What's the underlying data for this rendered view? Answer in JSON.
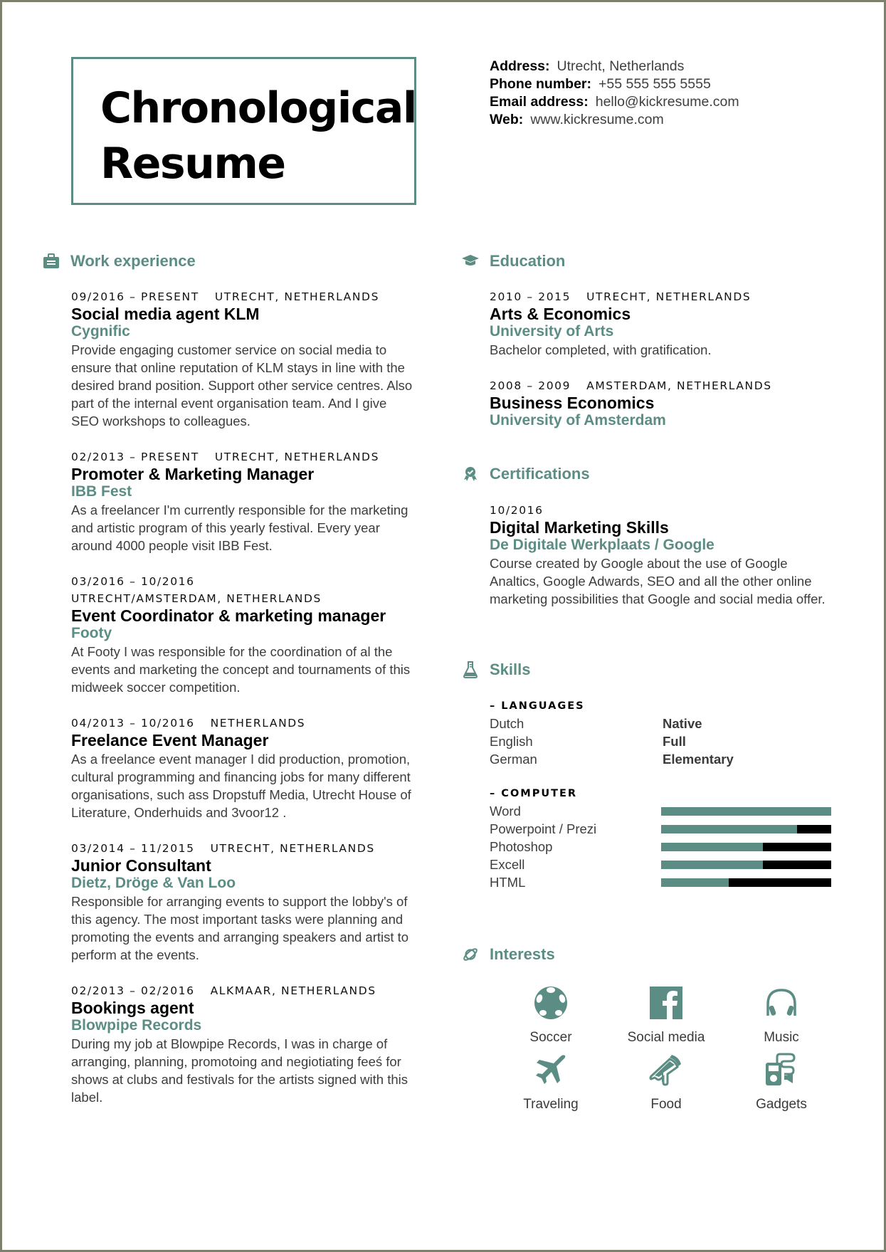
{
  "header": {
    "title_line1": "Chronological",
    "title_line2": "Resume"
  },
  "contact": [
    {
      "label": "Address:",
      "value": "Utrecht, Netherlands"
    },
    {
      "label": "Phone number:",
      "value": "+55 555 555 5555"
    },
    {
      "label": "Email address:",
      "value": "hello@kickresume.com"
    },
    {
      "label": "Web:",
      "value": "www.kickresume.com"
    }
  ],
  "colors": {
    "accent": "#5b8d84",
    "frame": "#7d806a",
    "bar_empty": "#000000"
  },
  "work": {
    "title": "Work experience",
    "icon": "briefcase-icon",
    "entries": [
      {
        "dates": "09/2016 – Present",
        "location": "Utrecht, Netherlands",
        "role": "Social media agent KLM",
        "org": "Cygnific",
        "desc": "Provide engaging customer service on social media to ensure that online reputation of KLM stays in line with the desired brand position. Support other service centres. Also part of the internal event organisation team. And I give SEO workshops to colleagues."
      },
      {
        "dates": "02/2013 – Present",
        "location": "Utrecht, Netherlands",
        "role": "Promoter & Marketing Manager",
        "org": "IBB Fest",
        "desc": "As a freelancer I'm currently responsible for the marketing and artistic program of this yearly festival. Every year around 4000 people visit IBB Fest."
      },
      {
        "dates": "03/2016 – 10/2016",
        "location": "Utrecht/Amsterdam, Netherlands",
        "role": "Event Coordinator & marketing manager",
        "org": "Footy",
        "desc": "At Footy I was responsible for the coordination of al the events and marketing the concept and tournaments of this midweek soccer competition."
      },
      {
        "dates": "04/2013 – 10/2016",
        "location": "Netherlands",
        "role": "Freelance Event Manager",
        "org": "",
        "desc": "As a freelance event manager I did production, promotion, cultural programming and financing jobs for many different organisations, such ass Dropstuff Media, Utrecht House of Literature, Onderhuids and 3voor12 ."
      },
      {
        "dates": "03/2014 – 11/2015",
        "location": "Utrecht, Netherlands",
        "role": "Junior Consultant",
        "org": "Dietz, Dröge & Van Loo",
        "desc": "Responsible for arranging events to support the lobby's of this agency. The most important tasks were planning and promoting the events and arranging speakers and artist to perform at the events."
      },
      {
        "dates": "02/2013 – 02/2016",
        "location": "Alkmaar, Netherlands",
        "role": "Bookings agent",
        "org": "Blowpipe Records",
        "desc": "During my job at Blowpipe Records, I was in charge of arranging, planning, promotoing  and negiotiating feeś for shows at clubs and festivals for the artists signed with this label."
      }
    ]
  },
  "education": {
    "title": "Education",
    "icon": "graduation-cap-icon",
    "entries": [
      {
        "dates": "2010 – 2015",
        "location": "Utrecht, Netherlands",
        "role": "Arts & Economics",
        "org": "University of Arts",
        "desc": "Bachelor completed, with gratification."
      },
      {
        "dates": "2008 – 2009",
        "location": "Amsterdam, Netherlands",
        "role": "Business Economics",
        "org": "University of Amsterdam",
        "desc": ""
      }
    ]
  },
  "certifications": {
    "title": "Certifications",
    "icon": "award-badge-icon",
    "entries": [
      {
        "dates": "10/2016",
        "location": "",
        "role": "Digital Marketing Skills",
        "org": "De Digitale Werkplaats / Google",
        "desc": "Course created by Google about the use of Google Analtics, Google Adwards, SEO and all the other online marketing possibilities that Google and social media offer."
      }
    ]
  },
  "skills": {
    "title": "Skills",
    "icon": "flask-icon",
    "languages_label": "– Languages",
    "languages": [
      {
        "name": "Dutch",
        "level": "Native"
      },
      {
        "name": "English",
        "level": "Full"
      },
      {
        "name": "German",
        "level": "Elementary"
      }
    ],
    "computer_label": "– Computer",
    "computer": [
      {
        "name": "Word",
        "level": 1.0
      },
      {
        "name": "Powerpoint / Prezi",
        "level": 0.8
      },
      {
        "name": "Photoshop",
        "level": 0.6
      },
      {
        "name": "Excell",
        "level": 0.6
      },
      {
        "name": "HTML",
        "level": 0.4
      }
    ]
  },
  "interests": {
    "title": "Interests",
    "icon": "planet-icon",
    "items": [
      {
        "label": "Soccer",
        "icon": "soccer-ball-icon"
      },
      {
        "label": "Social media",
        "icon": "facebook-icon"
      },
      {
        "label": "Music",
        "icon": "headphones-icon"
      },
      {
        "label": "Traveling",
        "icon": "airplane-icon"
      },
      {
        "label": "Food",
        "icon": "pizza-slice-icon"
      },
      {
        "label": "Gadgets",
        "icon": "music-player-icon"
      }
    ]
  }
}
